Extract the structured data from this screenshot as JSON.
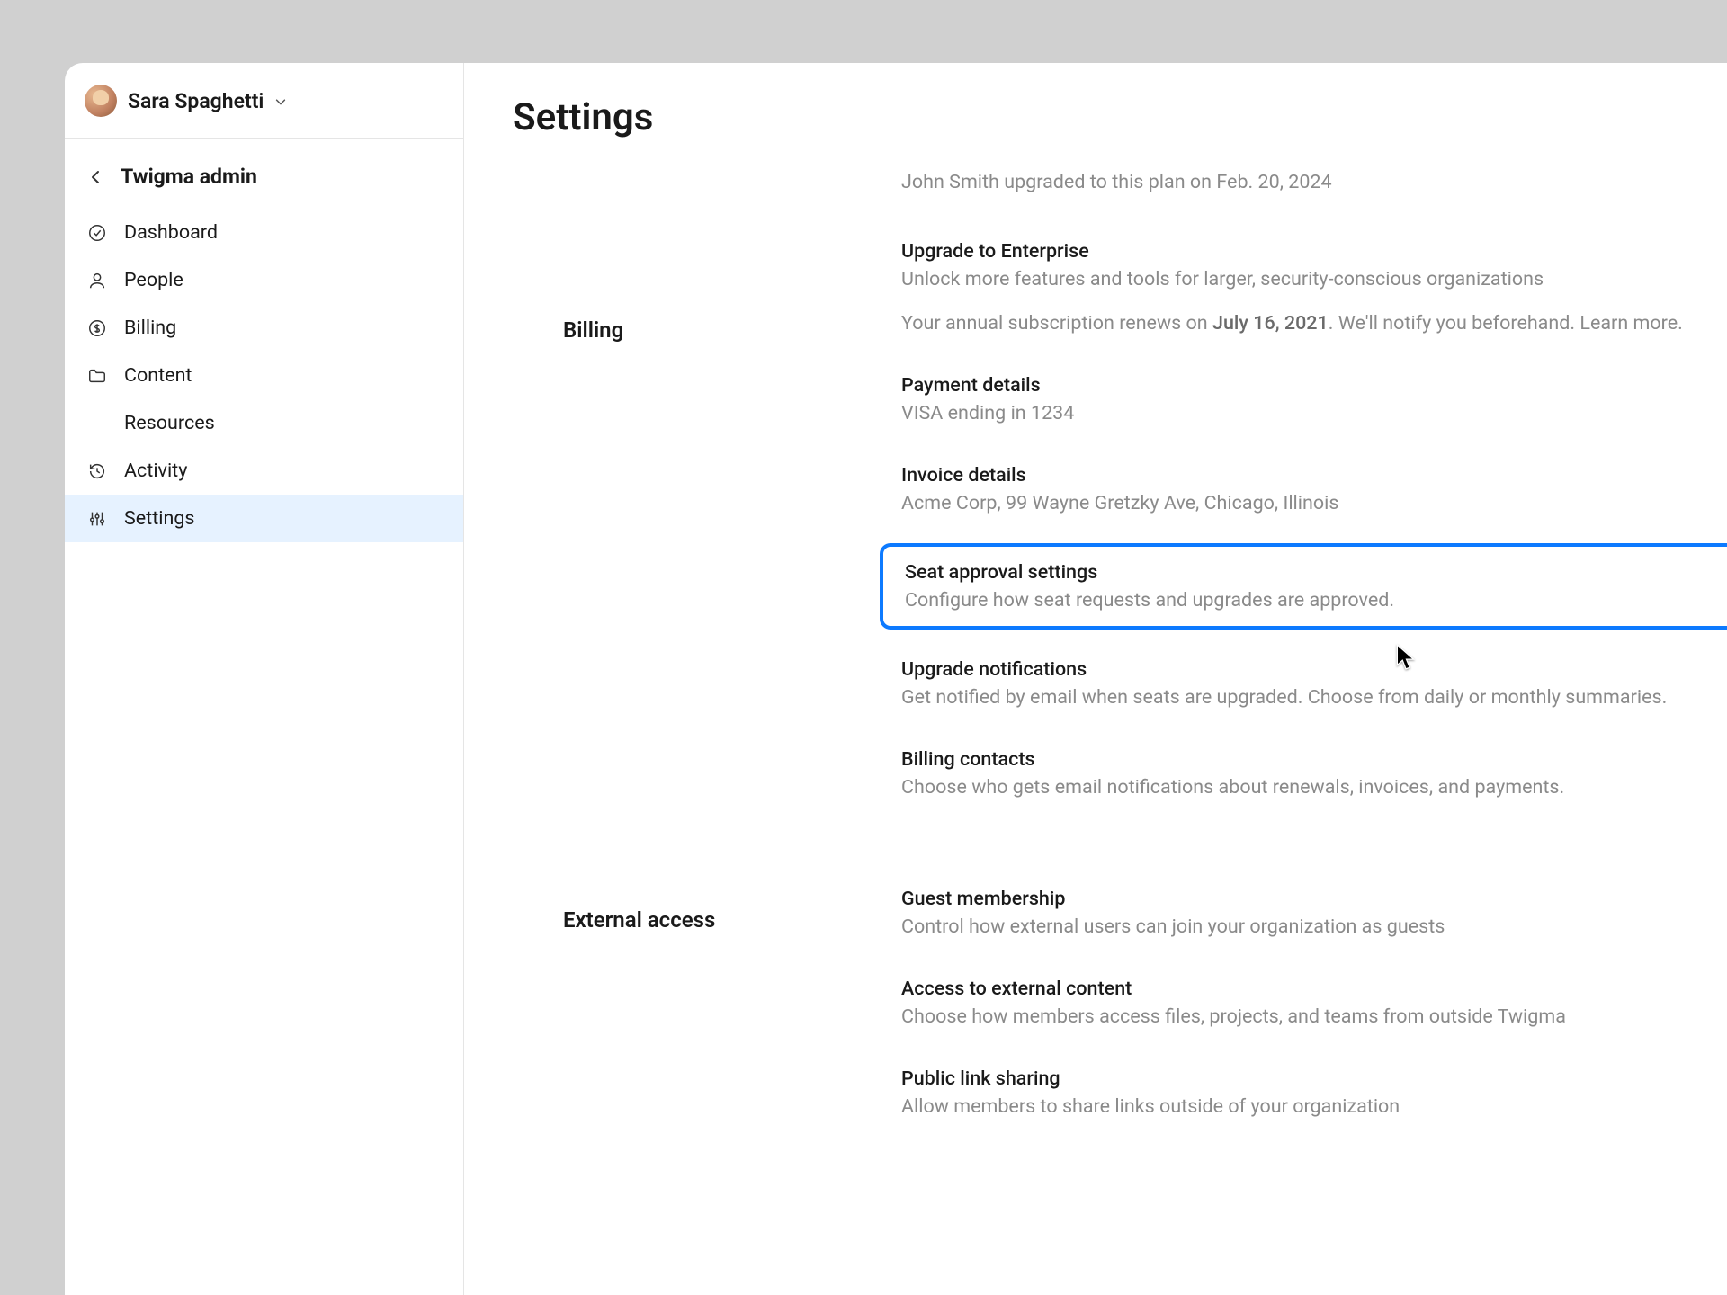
{
  "user": {
    "name": "Sara Spaghetti"
  },
  "sidebar": {
    "admin_title": "Twigma admin",
    "items": [
      {
        "label": "Dashboard"
      },
      {
        "label": "People"
      },
      {
        "label": "Billing"
      },
      {
        "label": "Content"
      },
      {
        "label": "Resources"
      },
      {
        "label": "Activity"
      },
      {
        "label": "Settings"
      }
    ]
  },
  "page": {
    "title": "Settings"
  },
  "plan": {
    "history": "John Smith upgraded to this plan on Feb. 20, 2024",
    "upgrade_title": "Upgrade to Enterprise",
    "upgrade_desc": "Unlock more features and tools for larger, security-conscious organizations"
  },
  "billing": {
    "section_label": "Billing",
    "renewal_prefix": "Your annual subscription renews on ",
    "renewal_date": "July 16, 2021",
    "renewal_suffix": ". We'll notify you beforehand. Learn more.",
    "payment_title": "Payment details",
    "payment_desc": "VISA ending in 1234",
    "invoice_title": "Invoice details",
    "invoice_desc": "Acme Corp, 99 Wayne Gretzky Ave, Chicago, Illinois",
    "seat_title": "Seat approval settings",
    "seat_desc": "Configure how seat requests and upgrades are approved.",
    "notify_title": "Upgrade notifications",
    "notify_desc": "Get notified by email when seats are upgraded. Choose from daily or monthly summaries.",
    "contacts_title": "Billing contacts",
    "contacts_desc": "Choose who gets email notifications about renewals, invoices, and payments."
  },
  "external": {
    "section_label": "External access",
    "guest_title": "Guest membership",
    "guest_desc": "Control how external users can join your organization as guests",
    "access_title": "Access to external content",
    "access_desc": "Choose how members access files, projects, and teams from outside Twigma",
    "link_title": "Public link sharing",
    "link_desc": "Allow members to share links outside of your organization"
  }
}
